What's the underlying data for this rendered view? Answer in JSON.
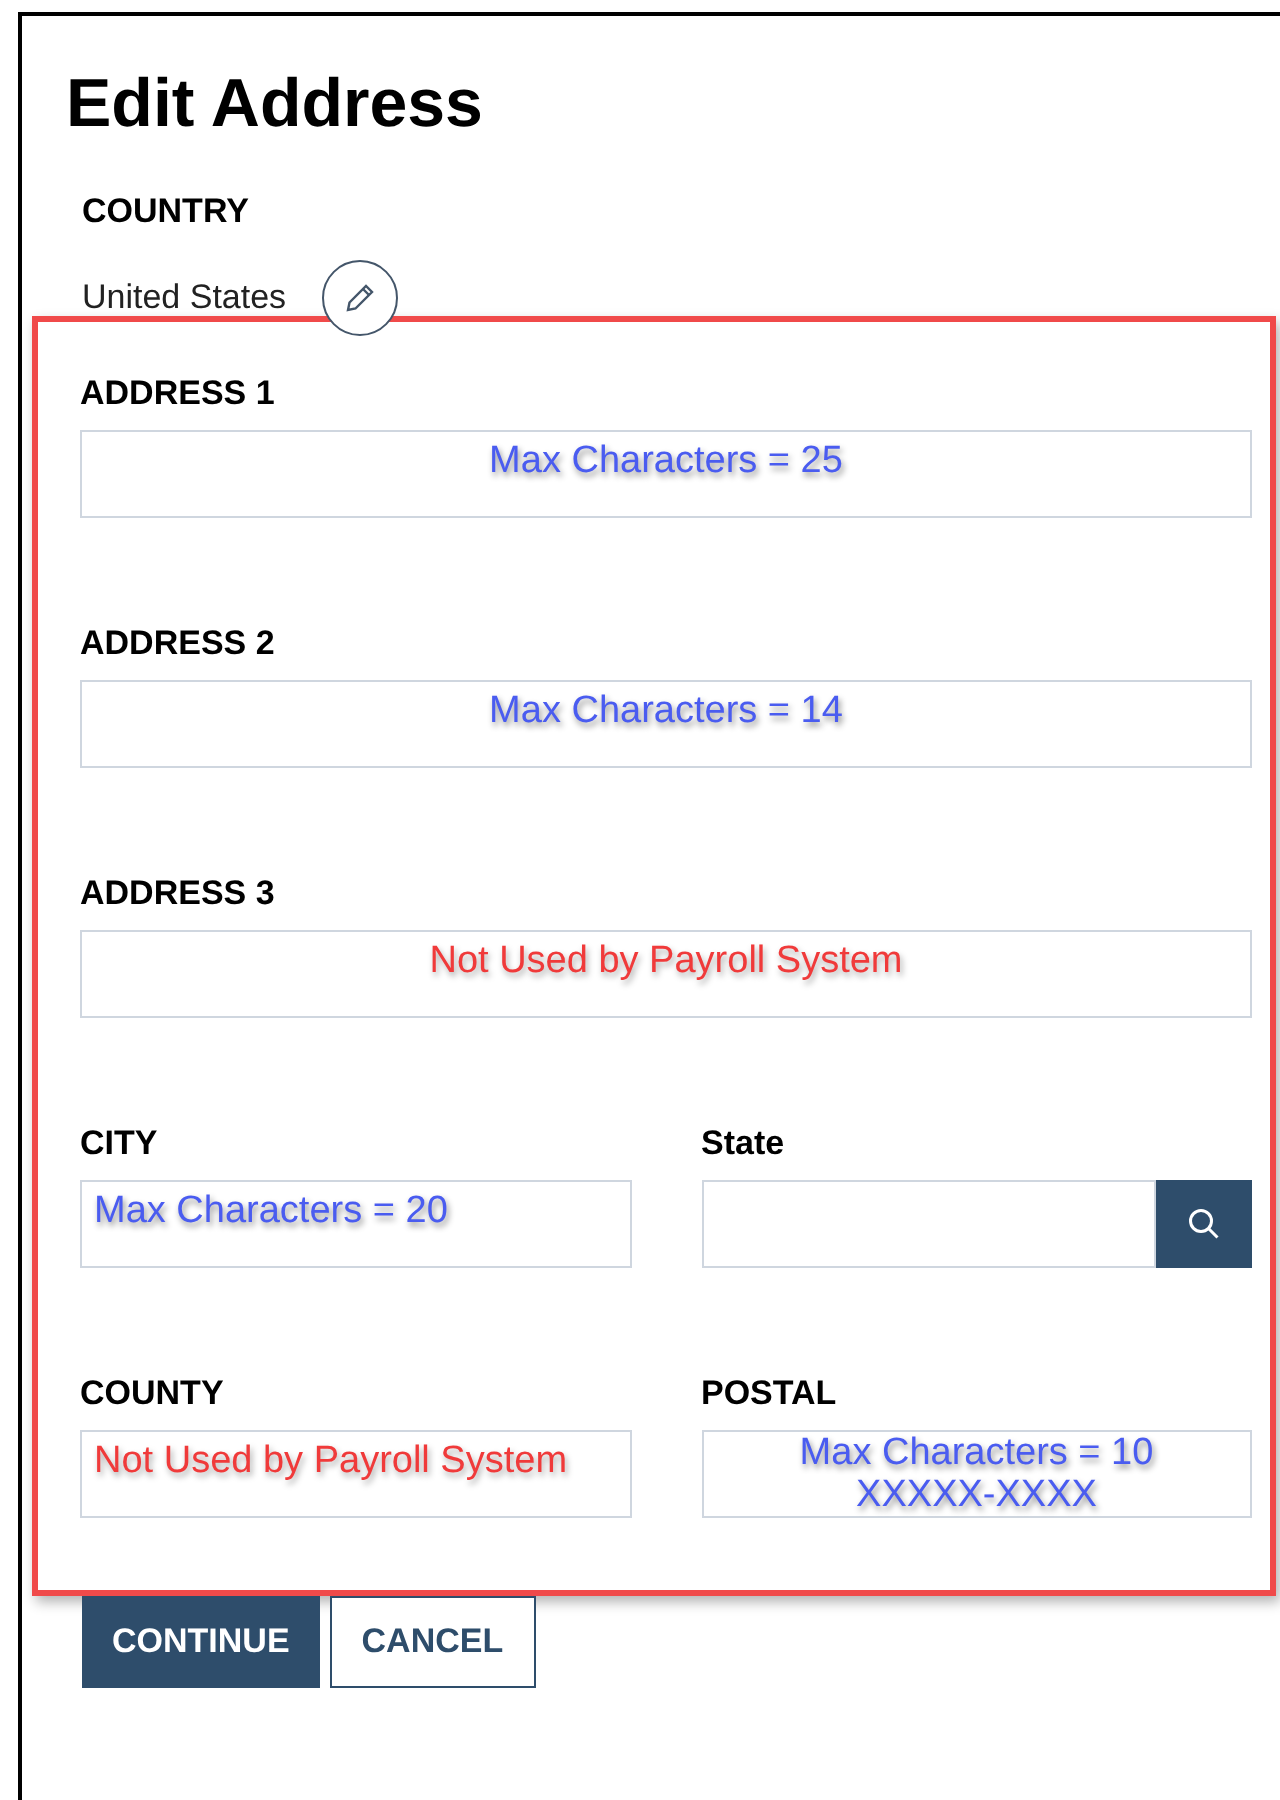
{
  "title": "Edit Address",
  "country": {
    "label": "COUNTRY",
    "value": "United States"
  },
  "rows": [
    [
      {
        "label": "ADDRESS 1",
        "kind": "text",
        "note": {
          "kind": "limit",
          "lines": [
            "Max Characters = 25"
          ]
        }
      }
    ],
    [
      {
        "label": "ADDRESS 2",
        "kind": "text",
        "note": {
          "kind": "limit",
          "lines": [
            "Max Characters = 14"
          ]
        }
      }
    ],
    [
      {
        "label": "ADDRESS 3",
        "kind": "text",
        "note": {
          "kind": "unused",
          "lines": [
            "Not Used by Payroll System"
          ]
        }
      }
    ],
    [
      {
        "label": "CITY",
        "kind": "text",
        "note": {
          "kind": "limit",
          "lines": [
            "Max Characters = 20"
          ]
        }
      },
      {
        "label": "State",
        "kind": "lookup"
      }
    ],
    [
      {
        "label": "COUNTY",
        "kind": "text",
        "note": {
          "kind": "unused",
          "lines": [
            "Not Used by Payroll System"
          ]
        }
      },
      {
        "label": "POSTAL",
        "kind": "text",
        "note": {
          "kind": "limit",
          "lines": [
            "Max Characters = 10",
            "XXXXX-XXXX"
          ]
        }
      }
    ]
  ],
  "buttons": [
    {
      "label": "CONTINUE",
      "kind": "primary"
    },
    {
      "label": "CANCEL",
      "kind": "secondary"
    }
  ]
}
